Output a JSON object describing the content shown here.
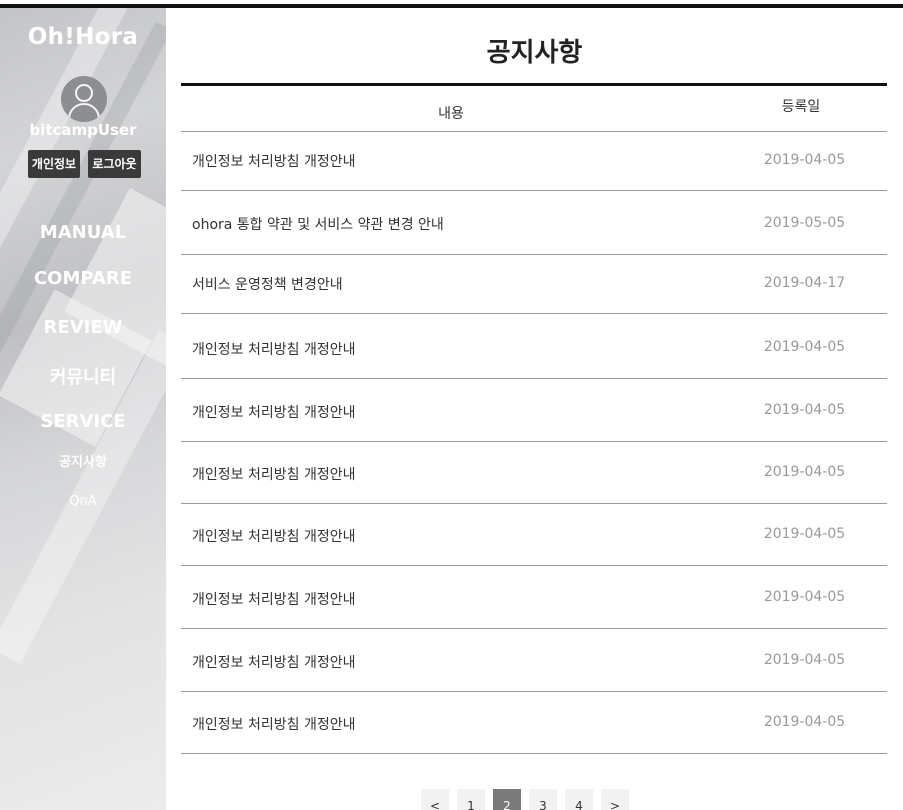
{
  "sidebar": {
    "brand": "Oh!Hora",
    "username": "bitcampUser",
    "profile_button": "개인정보",
    "logout_button": "로그아웃",
    "nav": [
      "MANUAL",
      "COMPARE",
      "REVIEW",
      "커뮤니티",
      "SERVICE"
    ],
    "subnav": [
      "공지사항",
      "QnA"
    ]
  },
  "main": {
    "title": "공지사항",
    "columns": {
      "content": "내용",
      "date": "등록일"
    },
    "rows": [
      {
        "title": "개인정보 처리방침 개정안내",
        "date": "2019-04-05"
      },
      {
        "title": "ohora 통합 약관 및 서비스 약관 변경 안내",
        "date": "2019-05-05"
      },
      {
        "title": "서비스 운영정책 변경안내",
        "date": "2019-04-17"
      },
      {
        "title": "개인정보 처리방침 개정안내",
        "date": "2019-04-05"
      },
      {
        "title": "개인정보 처리방침 개정안내",
        "date": "2019-04-05"
      },
      {
        "title": "개인정보 처리방침 개정안내",
        "date": "2019-04-05"
      },
      {
        "title": "개인정보 처리방침 개정안내",
        "date": "2019-04-05"
      },
      {
        "title": "개인정보 처리방침 개정안내",
        "date": "2019-04-05"
      },
      {
        "title": "개인정보 처리방침 개정안내",
        "date": "2019-04-05"
      },
      {
        "title": "개인정보 처리방침 개정안내",
        "date": "2019-04-05"
      }
    ]
  },
  "pagination": {
    "prev": "<",
    "pages": [
      "1",
      "2",
      "3",
      "4"
    ],
    "current": "2",
    "next": ">"
  },
  "colors": {
    "accent_rule": "#111111",
    "sidebar_button": "#3a3a3a",
    "active_page": "#7a7a7a",
    "date_text": "#999999"
  },
  "icons": {
    "avatar": "user-avatar-icon"
  }
}
